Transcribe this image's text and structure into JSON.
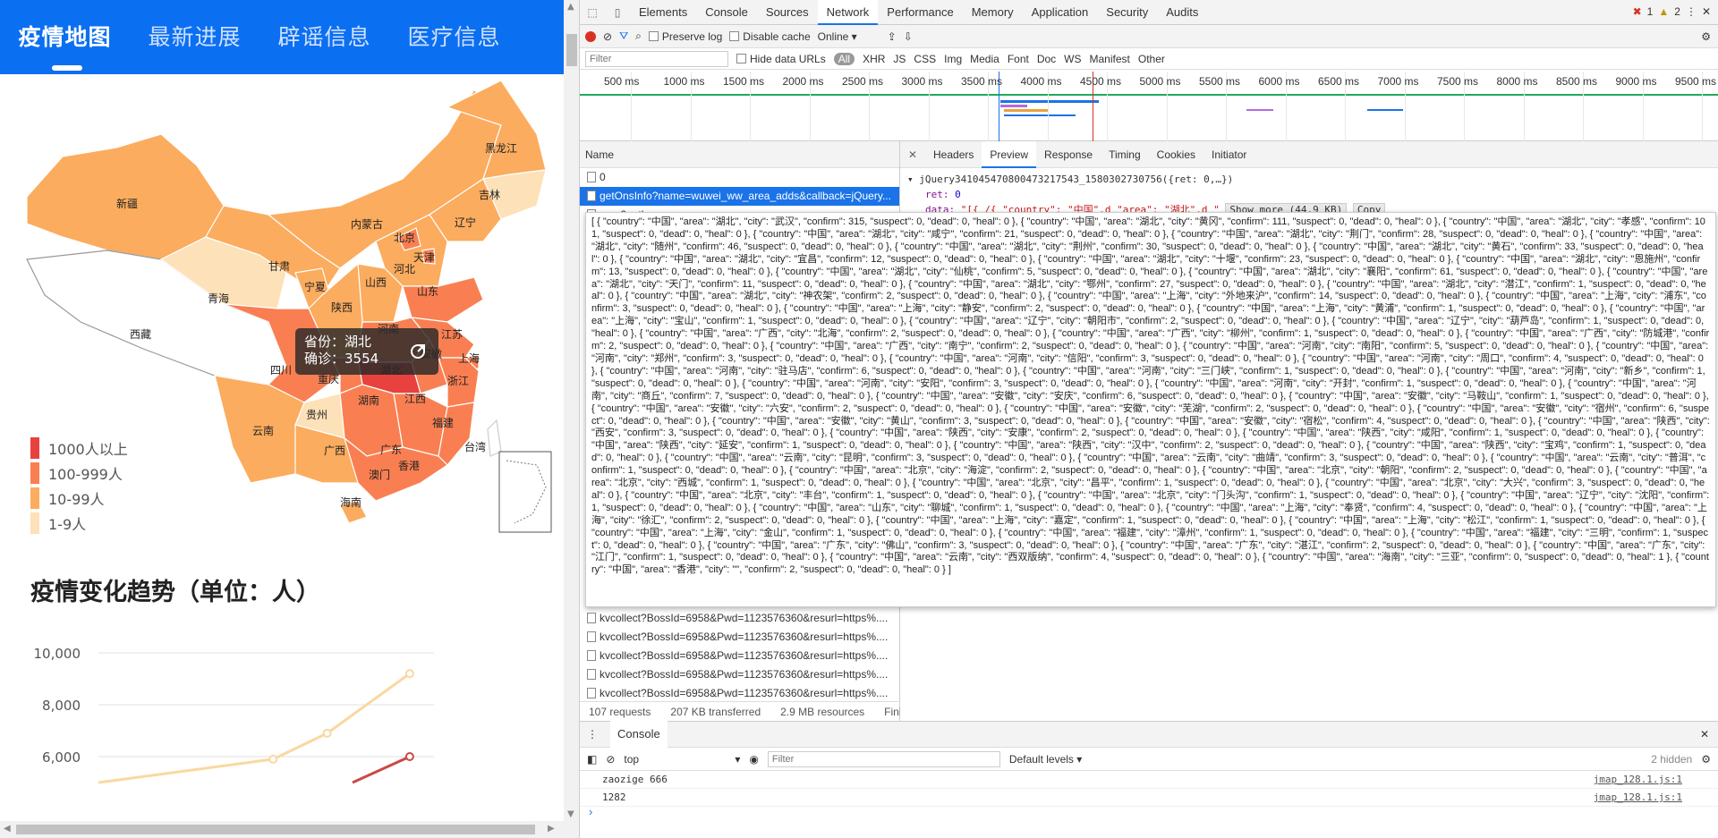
{
  "nav": {
    "tabs": [
      {
        "label": "疫情地图"
      },
      {
        "label": "最新进展"
      },
      {
        "label": "辟谣信息"
      },
      {
        "label": "医疗信息"
      }
    ]
  },
  "map": {
    "provinces": [
      "黑龙江",
      "吉林",
      "辽宁",
      "新疆",
      "内蒙古",
      "北京",
      "天津",
      "河北",
      "甘肃",
      "宁夏",
      "山西",
      "山东",
      "青海",
      "陕西",
      "河南",
      "江苏",
      "西藏",
      "四川",
      "重庆",
      "湖北",
      "安徽",
      "上海",
      "浙江",
      "湖南",
      "江西",
      "贵州",
      "云南",
      "福建",
      "广西",
      "广东",
      "台湾",
      "香港",
      "澳门",
      "海南"
    ],
    "tooltip": {
      "province_label": "省份：湖北",
      "confirm_label": "确诊：3554"
    },
    "legend": [
      {
        "label": "1000人以上",
        "color": "#e8423f"
      },
      {
        "label": "100-999人",
        "color": "#f97f52"
      },
      {
        "label": "10-99人",
        "color": "#fbac5e"
      },
      {
        "label": "1-9人",
        "color": "#fde1b8"
      }
    ]
  },
  "trend": {
    "title": "疫情变化趋势（单位：人）"
  },
  "chart_data": {
    "type": "line",
    "title": "疫情变化趋势（单位：人）",
    "ylim": [
      5000,
      10000
    ],
    "yticks": [
      "10,000",
      "8,000",
      "6,000"
    ],
    "series": [
      {
        "color": "#f9d8a0",
        "points": [
          [
            0.0,
            5000
          ],
          [
            0.55,
            5900
          ],
          [
            0.72,
            6900
          ],
          [
            0.98,
            9200
          ]
        ]
      },
      {
        "color": "#c94a44",
        "points": [
          [
            0.8,
            5000
          ],
          [
            0.98,
            6000
          ]
        ]
      }
    ]
  },
  "devtools": {
    "tabs": [
      "Elements",
      "Console",
      "Sources",
      "Network",
      "Performance",
      "Memory",
      "Application",
      "Security",
      "Audits"
    ],
    "errors": "1",
    "warnings": "2",
    "toolbar": {
      "preserve_log": "Preserve log",
      "disable_cache": "Disable cache",
      "throttle": "Online"
    },
    "filter": {
      "placeholder": "Filter",
      "hide_data_urls": "Hide data URLs",
      "all": "All",
      "types": [
        "XHR",
        "JS",
        "CSS",
        "Img",
        "Media",
        "Font",
        "Doc",
        "WS",
        "Manifest",
        "Other"
      ]
    },
    "timeline_ticks": [
      "500 ms",
      "1000 ms",
      "1500 ms",
      "2000 ms",
      "2500 ms",
      "3000 ms",
      "3500 ms",
      "4000 ms",
      "4500 ms",
      "5000 ms",
      "5500 ms",
      "6000 ms",
      "6500 ms",
      "7000 ms",
      "7500 ms",
      "8000 ms",
      "8500 ms",
      "9000 ms",
      "9500 ms"
    ],
    "name_header": "Name",
    "requests_top": [
      {
        "name": "0",
        "selected": false
      },
      {
        "name": "getOnsInfo?name=wuwei_ww_area_adds&callback=jQuery...",
        "selected": true
      },
      {
        "name": "map2_atlas_.png",
        "selected": false
      }
    ],
    "requests_bottom": [
      "kvcollect?BossId=6958&Pwd=1123576360&resurl=https%....",
      "kvcollect?BossId=6958&Pwd=1123576360&resurl=https%....",
      "kvcollect?BossId=6958&Pwd=1123576360&resurl=https%....",
      "kvcollect?BossId=6958&Pwd=1123576360&resurl=https%....",
      "kvcollect?BossId=6958&Pwd=1123576360&resurl=https%...."
    ],
    "detail_tabs": [
      "Headers",
      "Preview",
      "Response",
      "Timing",
      "Cookies",
      "Initiator"
    ],
    "preview_line1": "▾ jQuery341045470800473217543_1580302730756({ret: 0,…})",
    "preview_ret_key": "ret:",
    "preview_ret_val": "0",
    "preview_data_key": "data:",
    "preview_data_val": "\"[{ /{    \"country\": \"中国\",d    \"area\": \"湖北\",d    \"",
    "show_more": "Show more (44.9 KB)",
    "copy": "Copy",
    "popup_text": "[ { \"country\": \"中国\", \"area\": \"湖北\", \"city\": \"武汉\", \"confirm\": 315, \"suspect\": 0, \"dead\": 0, \"heal\": 0 }, { \"country\": \"中国\", \"area\": \"湖北\", \"city\": \"黄冈\", \"confirm\": 111, \"suspect\": 0, \"dead\": 0, \"heal\": 0 }, { \"country\": \"中国\", \"area\": \"湖北\", \"city\": \"孝感\", \"confirm\": 101, \"suspect\": 0, \"dead\": 0, \"heal\": 0 }, { \"country\": \"中国\", \"area\": \"湖北\", \"city\": \"咸宁\", \"confirm\": 21, \"suspect\": 0, \"dead\": 0, \"heal\": 0 }, { \"country\": \"中国\", \"area\": \"湖北\", \"city\": \"荆门\", \"confirm\": 28, \"suspect\": 0, \"dead\": 0, \"heal\": 0 }, { \"country\": \"中国\", \"area\": \"湖北\", \"city\": \"随州\", \"confirm\": 46, \"suspect\": 0, \"dead\": 0, \"heal\": 0 }, { \"country\": \"中国\", \"area\": \"湖北\", \"city\": \"荆州\", \"confirm\": 30, \"suspect\": 0, \"dead\": 0, \"heal\": 0 }, { \"country\": \"中国\", \"area\": \"湖北\", \"city\": \"黄石\", \"confirm\": 33, \"suspect\": 0, \"dead\": 0, \"heal\": 0 }, { \"country\": \"中国\", \"area\": \"湖北\", \"city\": \"宜昌\", \"confirm\": 12, \"suspect\": 0, \"dead\": 0, \"heal\": 0 }, { \"country\": \"中国\", \"area\": \"湖北\", \"city\": \"十堰\", \"confirm\": 23, \"suspect\": 0, \"dead\": 0, \"heal\": 0 }, { \"country\": \"中国\", \"area\": \"湖北\", \"city\": \"恩施州\", \"confirm\": 13, \"suspect\": 0, \"dead\": 0, \"heal\": 0 }, { \"country\": \"中国\", \"area\": \"湖北\", \"city\": \"仙桃\", \"confirm\": 5, \"suspect\": 0, \"dead\": 0, \"heal\": 0 }, { \"country\": \"中国\", \"area\": \"湖北\", \"city\": \"襄阳\", \"confirm\": 61, \"suspect\": 0, \"dead\": 0, \"heal\": 0 }, { \"country\": \"中国\", \"area\": \"湖北\", \"city\": \"天门\", \"confirm\": 11, \"suspect\": 0, \"dead\": 0, \"heal\": 0 }, { \"country\": \"中国\", \"area\": \"湖北\", \"city\": \"鄂州\", \"confirm\": 27, \"suspect\": 0, \"dead\": 0, \"heal\": 0 }, { \"country\": \"中国\", \"area\": \"湖北\", \"city\": \"潜江\", \"confirm\": 1, \"suspect\": 0, \"dead\": 0, \"heal\": 0 }, { \"country\": \"中国\", \"area\": \"湖北\", \"city\": \"神农架\", \"confirm\": 2, \"suspect\": 0, \"dead\": 0, \"heal\": 0 }, { \"country\": \"中国\", \"area\": \"上海\", \"city\": \"外地来沪\", \"confirm\": 14, \"suspect\": 0, \"dead\": 0, \"heal\": 0 }, { \"country\": \"中国\", \"area\": \"上海\", \"city\": \"浦东\", \"confirm\": 3, \"suspect\": 0, \"dead\": 0, \"heal\": 0 }, { \"country\": \"中国\", \"area\": \"上海\", \"city\": \"静安\", \"confirm\": 2, \"suspect\": 0, \"dead\": 0, \"heal\": 0 }, { \"country\": \"中国\", \"area\": \"上海\", \"city\": \"黄浦\", \"confirm\": 1, \"suspect\": 0, \"dead\": 0, \"heal\": 0 }, { \"country\": \"中国\", \"area\": \"上海\", \"city\": \"宝山\", \"confirm\": 1, \"suspect\": 0, \"dead\": 0, \"heal\": 0 }, { \"country\": \"中国\", \"area\": \"辽宁\", \"city\": \"朝阳市\", \"confirm\": 2, \"suspect\": 0, \"dead\": 0, \"heal\": 0 }, { \"country\": \"中国\", \"area\": \"辽宁\", \"city\": \"葫芦岛\", \"confirm\": 1, \"suspect\": 0, \"dead\": 0, \"heal\": 0 }, { \"country\": \"中国\", \"area\": \"广西\", \"city\": \"北海\", \"confirm\": 2, \"suspect\": 0, \"dead\": 0, \"heal\": 0 }, { \"country\": \"中国\", \"area\": \"广西\", \"city\": \"柳州\", \"confirm\": 1, \"suspect\": 0, \"dead\": 0, \"heal\": 0 }, { \"country\": \"中国\", \"area\": \"广西\", \"city\": \"防城港\", \"confirm\": 2, \"suspect\": 0, \"dead\": 0, \"heal\": 0 }, { \"country\": \"中国\", \"area\": \"广西\", \"city\": \"南宁\", \"confirm\": 2, \"suspect\": 0, \"dead\": 0, \"heal\": 0 }, { \"country\": \"中国\", \"area\": \"河南\", \"city\": \"南阳\", \"confirm\": 5, \"suspect\": 0, \"dead\": 0, \"heal\": 0 }, { \"country\": \"中国\", \"area\": \"河南\", \"city\": \"郑州\", \"confirm\": 3, \"suspect\": 0, \"dead\": 0, \"heal\": 0 }, { \"country\": \"中国\", \"area\": \"河南\", \"city\": \"信阳\", \"confirm\": 3, \"suspect\": 0, \"dead\": 0, \"heal\": 0 }, { \"country\": \"中国\", \"area\": \"河南\", \"city\": \"周口\", \"confirm\": 4, \"suspect\": 0, \"dead\": 0, \"heal\": 0 }, { \"country\": \"中国\", \"area\": \"河南\", \"city\": \"驻马店\", \"confirm\": 6, \"suspect\": 0, \"dead\": 0, \"heal\": 0 }, { \"country\": \"中国\", \"area\": \"河南\", \"city\": \"三门峡\", \"confirm\": 1, \"suspect\": 0, \"dead\": 0, \"heal\": 0 }, { \"country\": \"中国\", \"area\": \"河南\", \"city\": \"新乡\", \"confirm\": 1, \"suspect\": 0, \"dead\": 0, \"heal\": 0 }, { \"country\": \"中国\", \"area\": \"河南\", \"city\": \"安阳\", \"confirm\": 3, \"suspect\": 0, \"dead\": 0, \"heal\": 0 }, { \"country\": \"中国\", \"area\": \"河南\", \"city\": \"开封\", \"confirm\": 1, \"suspect\": 0, \"dead\": 0, \"heal\": 0 }, { \"country\": \"中国\", \"area\": \"河南\", \"city\": \"商丘\", \"confirm\": 7, \"suspect\": 0, \"dead\": 0, \"heal\": 0 }, { \"country\": \"中国\", \"area\": \"安徽\", \"city\": \"安庆\", \"confirm\": 6, \"suspect\": 0, \"dead\": 0, \"heal\": 0 }, { \"country\": \"中国\", \"area\": \"安徽\", \"city\": \"马鞍山\", \"confirm\": 1, \"suspect\": 0, \"dead\": 0, \"heal\": 0 }, { \"country\": \"中国\", \"area\": \"安徽\", \"city\": \"六安\", \"confirm\": 2, \"suspect\": 0, \"dead\": 0, \"heal\": 0 }, { \"country\": \"中国\", \"area\": \"安徽\", \"city\": \"芜湖\", \"confirm\": 2, \"suspect\": 0, \"dead\": 0, \"heal\": 0 }, { \"country\": \"中国\", \"area\": \"安徽\", \"city\": \"宿州\", \"confirm\": 6, \"suspect\": 0, \"dead\": 0, \"heal\": 0 }, { \"country\": \"中国\", \"area\": \"安徽\", \"city\": \"黄山\", \"confirm\": 3, \"suspect\": 0, \"dead\": 0, \"heal\": 0 }, { \"country\": \"中国\", \"area\": \"安徽\", \"city\": \"宿松\", \"confirm\": 4, \"suspect\": 0, \"dead\": 0, \"heal\": 0 }, { \"country\": \"中国\", \"area\": \"陕西\", \"city\": \"西安\", \"confirm\": 3, \"suspect\": 0, \"dead\": 0, \"heal\": 0 }, { \"country\": \"中国\", \"area\": \"陕西\", \"city\": \"安康\", \"confirm\": 2, \"suspect\": 0, \"dead\": 0, \"heal\": 0 }, { \"country\": \"中国\", \"area\": \"陕西\", \"city\": \"咸阳\", \"confirm\": 1, \"suspect\": 0, \"dead\": 0, \"heal\": 0 }, { \"country\": \"中国\", \"area\": \"陕西\", \"city\": \"延安\", \"confirm\": 1, \"suspect\": 0, \"dead\": 0, \"heal\": 0 }, { \"country\": \"中国\", \"area\": \"陕西\", \"city\": \"汉中\", \"confirm\": 2, \"suspect\": 0, \"dead\": 0, \"heal\": 0 }, { \"country\": \"中国\", \"area\": \"陕西\", \"city\": \"宝鸡\", \"confirm\": 1, \"suspect\": 0, \"dead\": 0, \"heal\": 0 }, { \"country\": \"中国\", \"area\": \"云南\", \"city\": \"昆明\", \"confirm\": 3, \"suspect\": 0, \"dead\": 0, \"heal\": 0 }, { \"country\": \"中国\", \"area\": \"云南\", \"city\": \"曲靖\", \"confirm\": 3, \"suspect\": 0, \"dead\": 0, \"heal\": 0 }, { \"country\": \"中国\", \"area\": \"云南\", \"city\": \"普洱\", \"confirm\": 1, \"suspect\": 0, \"dead\": 0, \"heal\": 0 }, { \"country\": \"中国\", \"area\": \"北京\", \"city\": \"海淀\", \"confirm\": 2, \"suspect\": 0, \"dead\": 0, \"heal\": 0 }, { \"country\": \"中国\", \"area\": \"北京\", \"city\": \"朝阳\", \"confirm\": 2, \"suspect\": 0, \"dead\": 0, \"heal\": 0 }, { \"country\": \"中国\", \"area\": \"北京\", \"city\": \"西城\", \"confirm\": 1, \"suspect\": 0, \"dead\": 0, \"heal\": 0 }, { \"country\": \"中国\", \"area\": \"北京\", \"city\": \"昌平\", \"confirm\": 1, \"suspect\": 0, \"dead\": 0, \"heal\": 0 }, { \"country\": \"中国\", \"area\": \"北京\", \"city\": \"大兴\", \"confirm\": 3, \"suspect\": 0, \"dead\": 0, \"heal\": 0 }, { \"country\": \"中国\", \"area\": \"北京\", \"city\": \"丰台\", \"confirm\": 1, \"suspect\": 0, \"dead\": 0, \"heal\": 0 }, { \"country\": \"中国\", \"area\": \"北京\", \"city\": \"门头沟\", \"confirm\": 1, \"suspect\": 0, \"dead\": 0, \"heal\": 0 }, { \"country\": \"中国\", \"area\": \"辽宁\", \"city\": \"沈阳\", \"confirm\": 1, \"suspect\": 0, \"dead\": 0, \"heal\": 0 }, { \"country\": \"中国\", \"area\": \"山东\", \"city\": \"聊城\", \"confirm\": 1, \"suspect\": 0, \"dead\": 0, \"heal\": 0 }, { \"country\": \"中国\", \"area\": \"上海\", \"city\": \"奉贤\", \"confirm\": 4, \"suspect\": 0, \"dead\": 0, \"heal\": 0 }, { \"country\": \"中国\", \"area\": \"上海\", \"city\": \"徐汇\", \"confirm\": 2, \"suspect\": 0, \"dead\": 0, \"heal\": 0 }, { \"country\": \"中国\", \"area\": \"上海\", \"city\": \"嘉定\", \"confirm\": 1, \"suspect\": 0, \"dead\": 0, \"heal\": 0 }, { \"country\": \"中国\", \"area\": \"上海\", \"city\": \"松江\", \"confirm\": 1, \"suspect\": 0, \"dead\": 0, \"heal\": 0 }, { \"country\": \"中国\", \"area\": \"上海\", \"city\": \"金山\", \"confirm\": 1, \"suspect\": 0, \"dead\": 0, \"heal\": 0 }, { \"country\": \"中国\", \"area\": \"福建\", \"city\": \"漳州\", \"confirm\": 1, \"suspect\": 0, \"dead\": 0, \"heal\": 0 }, { \"country\": \"中国\", \"area\": \"福建\", \"city\": \"三明\", \"confirm\": 1, \"suspect\": 0, \"dead\": 0, \"heal\": 0 }, { \"country\": \"中国\", \"area\": \"广东\", \"city\": \"佛山\", \"confirm\": 3, \"suspect\": 0, \"dead\": 0, \"heal\": 0 }, { \"country\": \"中国\", \"area\": \"广东\", \"city\": \"湛江\", \"confirm\": 2, \"suspect\": 0, \"dead\": 0, \"heal\": 0 }, { \"country\": \"中国\", \"area\": \"广东\", \"city\": \"江门\", \"confirm\": 1, \"suspect\": 0, \"dead\": 0, \"heal\": 0 }, { \"country\": \"中国\", \"area\": \"云南\", \"city\": \"西双版纳\", \"confirm\": 4, \"suspect\": 0, \"dead\": 0, \"heal\": 0 }, { \"country\": \"中国\", \"area\": \"海南\", \"city\": \"三亚\", \"confirm\": 0, \"suspect\": 0, \"dead\": 0, \"heal\": 1 }, { \"country\": \"中国\", \"area\": \"香港\", \"city\": \"\", \"confirm\": 2, \"suspect\": 0, \"dead\": 0, \"heal\": 0 } ]",
    "status": {
      "requests": "107 requests",
      "transferred": "207 KB transferred",
      "resources": "2.9 MB resources",
      "finish": "Finish:"
    },
    "console": {
      "tab": "Console",
      "context": "top",
      "filter_placeholder": "Filter",
      "levels": "Default levels",
      "hidden": "2 hidden",
      "lines": [
        {
          "text": "zaozige 666",
          "src": "jmap_128.1.js:1"
        },
        {
          "text": "1282",
          "src": "jmap_128.1.js:1"
        }
      ]
    }
  }
}
